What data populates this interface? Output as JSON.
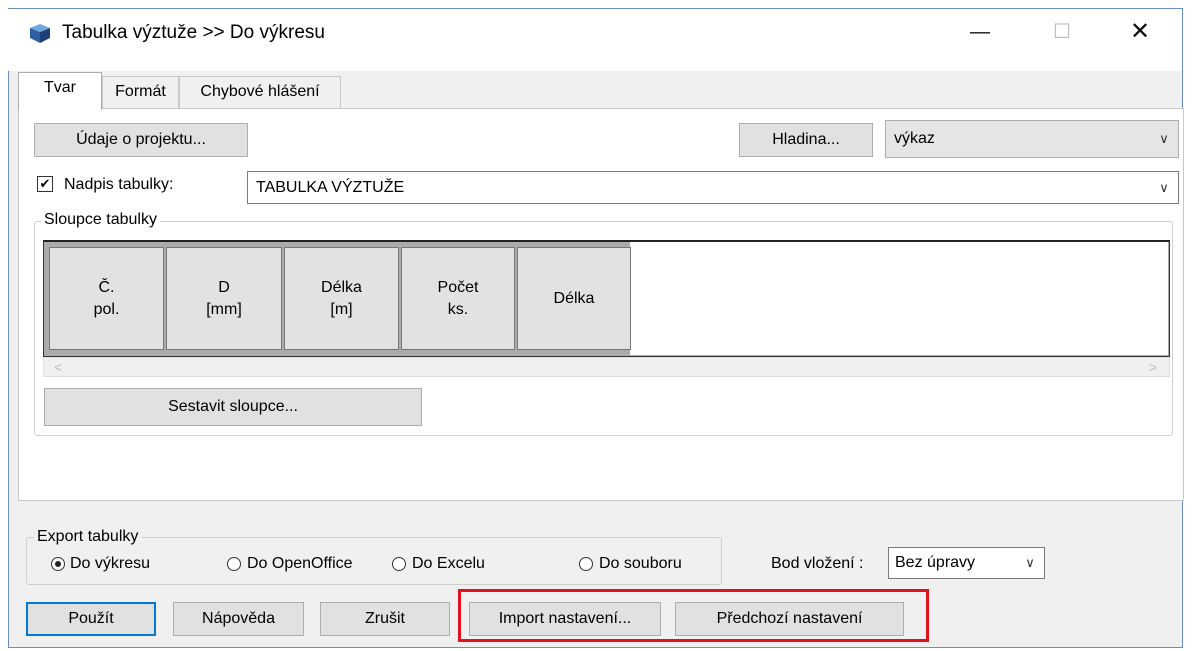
{
  "window": {
    "title": "Tabulka výztuže >> Do výkresu",
    "icon": "app-cube-icon"
  },
  "controls": {
    "minimize": "—",
    "maximize": "☐",
    "close": "✕"
  },
  "tabs": [
    {
      "label": "Tvar",
      "active": true
    },
    {
      "label": "Formát",
      "active": false
    },
    {
      "label": "Chybové hlášení",
      "active": false
    }
  ],
  "project_button": "Údaje o projektu...",
  "layer_button": "Hladina...",
  "layer_select": "výkaz",
  "heading": {
    "checkbox_label": "Nadpis tabulky:",
    "checked": true,
    "value": "TABULKA VÝZTUŽE"
  },
  "columns_group": {
    "title": "Sloupce tabulky",
    "columns": [
      {
        "line1": "Č.",
        "line2": "pol."
      },
      {
        "line1": "D",
        "line2": "[mm]"
      },
      {
        "line1": "Délka",
        "line2": "[m]"
      },
      {
        "line1": "Počet",
        "line2": "ks."
      },
      {
        "line1": "Délka",
        "line2": ""
      }
    ],
    "build_button": "Sestavit sloupce..."
  },
  "export": {
    "title": "Export tabulky",
    "options": [
      {
        "label": "Do výkresu",
        "checked": true
      },
      {
        "label": "Do OpenOffice",
        "checked": false
      },
      {
        "label": "Do Excelu",
        "checked": false
      },
      {
        "label": "Do souboru",
        "checked": false
      }
    ],
    "insert_label": "Bod vložení :",
    "insert_value": "Bez úpravy"
  },
  "buttons": {
    "apply": "Použít",
    "help": "Nápověda",
    "cancel": "Zrušit",
    "import": "Import nastavení...",
    "previous": "Předchozí nastavení"
  },
  "colors": {
    "accent": "#0078d7",
    "highlight": "#e0141e"
  }
}
